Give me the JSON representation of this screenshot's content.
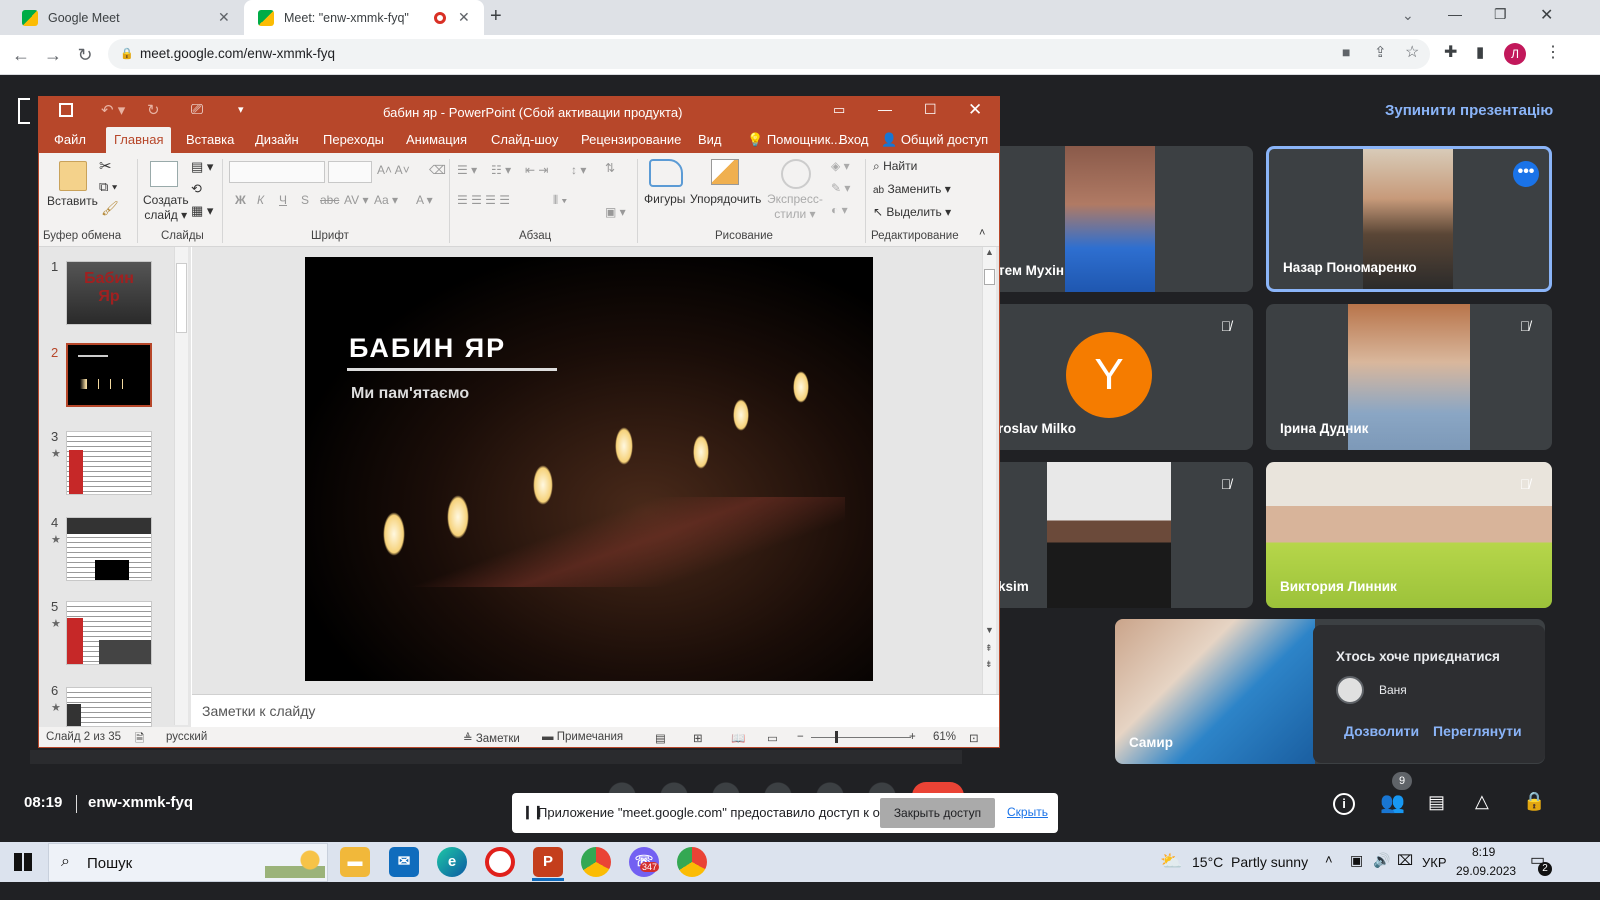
{
  "browser": {
    "tabs": [
      {
        "title": "Google Meet"
      },
      {
        "title": "Meet: \"enw-xmmk-fyq\""
      }
    ],
    "new_tab": "+",
    "url": "meet.google.com/enw-xmmk-fyq",
    "profile_initial": "Л"
  },
  "meet": {
    "stop_presenting": "Зупинити презентацію",
    "participants": [
      {
        "name": "тем Мухін"
      },
      {
        "name": "Назар Пономаренко"
      },
      {
        "name": "roslav Milko",
        "avatar_letter": "Y"
      },
      {
        "name": "Ірина Дудник"
      },
      {
        "name": "ksim"
      },
      {
        "name": "Виктория Линник"
      },
      {
        "name": "Самир"
      }
    ],
    "join_request": {
      "title": "Хтось хоче приєднатися",
      "user": "Ваня",
      "allow": "Дозволити",
      "view": "Переглянути"
    },
    "time": "08:19",
    "meeting_code": "enw-xmmk-fyq",
    "participants_count": "9",
    "share_notice": {
      "text": "Приложение \"meet.google.com\" предоставило доступ к окну.",
      "stop": "Закрыть доступ",
      "hide": "Скрыть"
    }
  },
  "ppt": {
    "title": "бабин яр - PowerPoint (Сбой активации продукта)",
    "menu": [
      "Файл",
      "Главная",
      "Вставка",
      "Дизайн",
      "Переходы",
      "Анимация",
      "Слайд-шоу",
      "Рецензирование",
      "Вид"
    ],
    "helper": "Помощник...",
    "login": "Вход",
    "share": "Общий доступ",
    "ribbon": {
      "paste": "Вставить",
      "create_slide_1": "Создать",
      "create_slide_2": "слайд",
      "shapes": "Фигуры",
      "arrange": "Упорядочить",
      "express_1": "Экспресс-",
      "express_2": "стили",
      "find": "Найти",
      "replace": "Заменить",
      "select": "Выделить",
      "groups": {
        "clipboard": "Буфер обмена",
        "slides": "Слайды",
        "font": "Шрифт",
        "paragraph": "Абзац",
        "drawing": "Рисование",
        "editing": "Редактирование"
      }
    },
    "thumb_numbers": [
      "1",
      "2",
      "3",
      "4",
      "5",
      "6"
    ],
    "slide_title": "БАБИН ЯР",
    "slide_subtitle": "Ми пам'ятаємо",
    "notes_placeholder": "Заметки к слайду",
    "status": {
      "slide": "Слайд 2 из 35",
      "language": "русский",
      "notes": "Заметки",
      "comments": "Примечания",
      "zoom": "61%"
    }
  },
  "taskbar": {
    "search": "Пошук",
    "weather": "15°C  Partly sunny",
    "lang": "УКР",
    "time": "8:19",
    "date": "29.09.2023",
    "notifications": "2",
    "viber_badge": "347"
  }
}
